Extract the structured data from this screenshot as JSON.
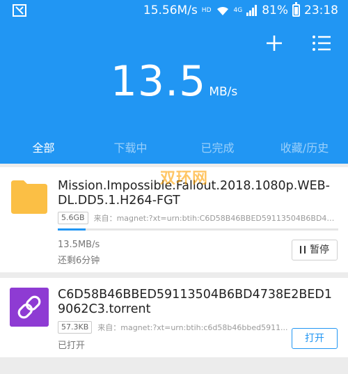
{
  "status_bar": {
    "app_icon": "app-logo-icon",
    "net_speed": "15.56M/s",
    "hd_label": "HD",
    "network_type": "4G",
    "battery": "81%",
    "time": "23:18"
  },
  "header": {
    "add_icon": "plus-icon",
    "menu_icon": "list-icon",
    "speed_value": "13.5",
    "speed_unit": "MB/s"
  },
  "tabs": [
    {
      "label": "全部",
      "active": true
    },
    {
      "label": "下载中",
      "active": false
    },
    {
      "label": "已完成",
      "active": false
    },
    {
      "label": "收藏/历史",
      "active": false
    }
  ],
  "watermark": "双环网",
  "downloads": [
    {
      "icon": "folder-icon",
      "title": "Mission.Impossible.Fallout.2018.1080p.WEB-DL.DD5.1.H264-FGT",
      "size": "5.6GB",
      "source": "来自：magnet:?xt=urn:btih:C6D58B46BBED59113504B6BD4738...",
      "progress": 0.1,
      "speed": "13.5MB/s",
      "remaining": "还剩6分钟",
      "button": "暂停"
    },
    {
      "icon": "torrent-link-icon",
      "title": "C6D58B46BBED59113504B6BD4738E2BED19062C3.torrent",
      "size": "57.3KB",
      "source": "来自：magnet:?xt=urn:btih:c6d58b46bbed5911...",
      "status": "已打开",
      "button": "打开"
    }
  ],
  "colors": {
    "accent": "#2196f3",
    "folder": "#fbbf45",
    "torrent": "#8e3bd3"
  }
}
